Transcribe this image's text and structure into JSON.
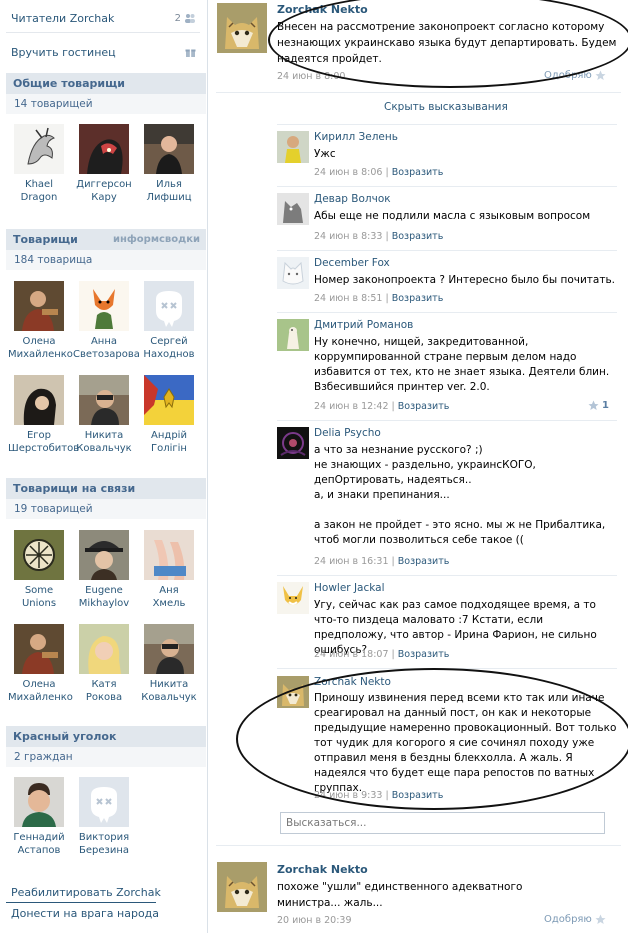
{
  "sidebar": {
    "readers": {
      "label": "Читатели Zorchak",
      "count": "2"
    },
    "gift": {
      "label": "Вручить гостинец"
    },
    "common": {
      "title": "Общие товарищи",
      "subtitle": "14 товарищей",
      "people": [
        {
          "first": "Khael",
          "last": "Dragon"
        },
        {
          "first": "Диггерсон",
          "last": "Кару"
        },
        {
          "first": "Илья",
          "last": "Лифшиц"
        }
      ]
    },
    "friends": {
      "title": "Товарищи",
      "extra": "информсводки",
      "subtitle": "184 товарища",
      "people": [
        {
          "first": "Олена",
          "last": "Михайленко"
        },
        {
          "first": "Анна",
          "last": "Светозарова"
        },
        {
          "first": "Сергей",
          "last": "Находнов"
        },
        {
          "first": "Егор",
          "last": "Шерстобитов"
        },
        {
          "first": "Никита",
          "last": "Ковальчук"
        },
        {
          "first": "Андрій",
          "last": "Голігін"
        }
      ]
    },
    "online": {
      "title": "Товарищи на связи",
      "subtitle": "19 товарищей",
      "people": [
        {
          "first": "Some",
          "last": "Unions"
        },
        {
          "first": "Eugene",
          "last": "Mikhaylov"
        },
        {
          "first": "Аня",
          "last": "Хмель"
        },
        {
          "first": "Олена",
          "last": "Михайленко"
        },
        {
          "first": "Катя",
          "last": "Рокова"
        },
        {
          "first": "Никита",
          "last": "Ковальчук"
        }
      ]
    },
    "corner": {
      "title": "Красный уголок",
      "subtitle": "2 граждан",
      "people": [
        {
          "first": "Геннадий",
          "last": "Астапов"
        },
        {
          "first": "Виктория",
          "last": "Березина"
        }
      ]
    },
    "rehab_link": "Реабилитировать Zorchak",
    "report_link": "Донести на врага народа"
  },
  "post1": {
    "author": "Zorchak Nekto",
    "text": "Внесен на рассмотрение законопроект согласно которому незнающих украинскаво языка будут департировать. Будем надеятся пройдет.",
    "date": "24 июн в 8:00",
    "like": "Одобряю"
  },
  "hide_comments": "Скрыть высказывания",
  "reply_label": "Возразить",
  "comments": [
    {
      "name": "Кирилл Зелень",
      "text": "Ужс",
      "date": "24 июн в 8:06"
    },
    {
      "name": "Девар Волчок",
      "text": "Абы еще не подлили масла с языковым вопросом",
      "date": "24 июн в 8:33"
    },
    {
      "name": "December Fox",
      "text": "Номер законопроекта ? Интересно было бы почитать.",
      "date": "24 июн в 8:51"
    },
    {
      "name": "Дмитрий Романов",
      "text": "Ну конечно, нищей, закредитованной, коррумпированной стране первым делом надо избавится от тех, кто не знает языка. Деятели блин. Взбесившийся принтер ver. 2.0.",
      "date": "24 июн в 12:42",
      "likes": "1"
    },
    {
      "name": "Delia Psycho",
      "text_lines": [
        "а что за незнание русского? ;)",
        "не знающих - раздельно, украинсКОГО, депОртировать, надеяться..",
        "а, и знаки препинания...",
        "",
        "а закон не пройдет - это ясно. мы ж не Прибалтика, чтоб могли позволиться себе такое (("
      ],
      "date": "24 июн в 16:31"
    },
    {
      "name": "Howler Jackal",
      "text": "Угу, сейчас как раз самое подходящее время, а то что-то пиздеца маловато :7 Кстати, если предположу, что автор - Ирина Фарион, не сильно ошибусь?",
      "date": "24 июн в 18:07"
    },
    {
      "name": "Zorchak Nekto",
      "text": "Приношу извинения перед всеми кто так или иначе среагировал на данный пост, он как и некоторые предыдущие намеренно провокационный. Вот только тот чудик для когорого я сие сочинял походу уже отправил меня в бездны блекхолла. А жаль. Я надеялся что будет еще пара репостов по ватных группах.",
      "date": "24 июн в 9:33"
    }
  ],
  "reply_placeholder": "Высказаться...",
  "post2": {
    "author": "Zorchak Nekto",
    "text": "похоже \"ушли\" единственного адекватного министра... жаль...",
    "date": "20 июн в 20:39",
    "like": "Одобряю"
  },
  "colors": {
    "link": "#2b587a",
    "header_bg": "#e1e7ed",
    "accent": "#45688e"
  }
}
